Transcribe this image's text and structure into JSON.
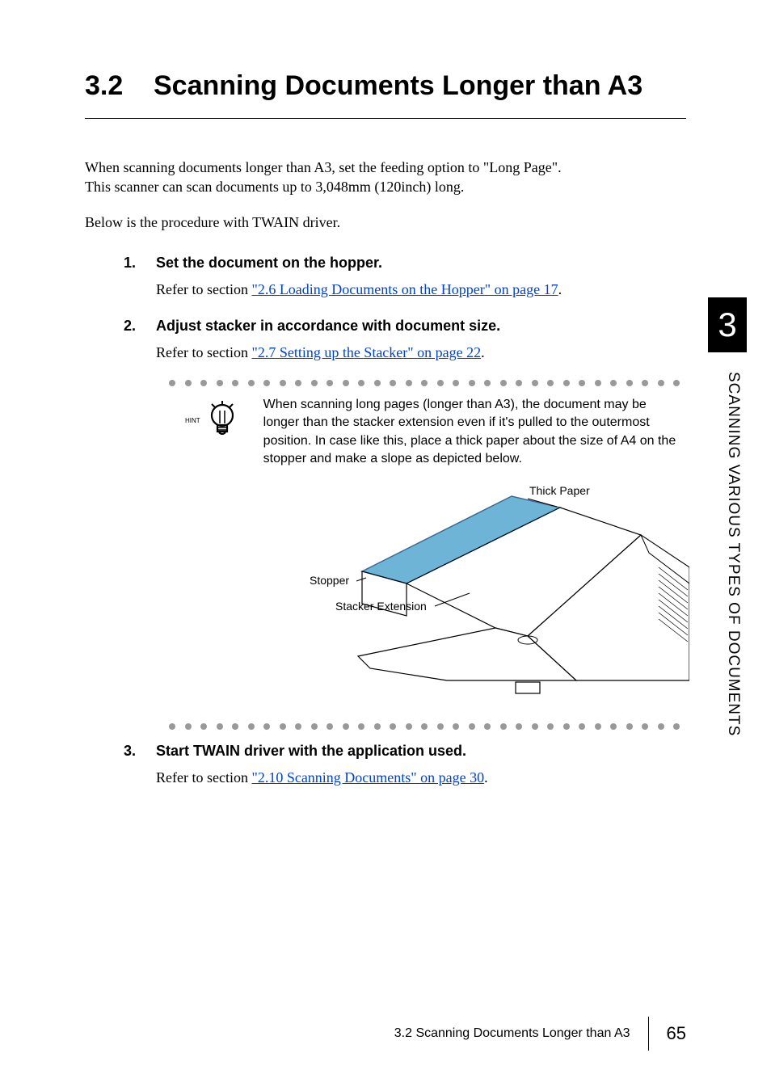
{
  "heading": {
    "num": "3.2",
    "title": "Scanning Documents Longer than A3"
  },
  "intro1_a": "When scanning documents longer than A3, set the feeding option to \"Long Page\".",
  "intro1_b": "This scanner can scan documents up to 3,048mm (120inch) long.",
  "intro2": "Below is the procedure with TWAIN driver.",
  "steps": [
    {
      "num": "1.",
      "title": "Set the document on the hopper.",
      "body_prefix": "Refer to section ",
      "link": "\"2.6 Loading Documents on the Hopper\" on page 17",
      "body_suffix": "."
    },
    {
      "num": "2.",
      "title": "Adjust stacker in accordance with document size.",
      "body_prefix": "Refer to section ",
      "link": "\"2.7 Setting up the Stacker\" on page 22",
      "body_suffix": "."
    },
    {
      "num": "3.",
      "title": "Start TWAIN driver with the application used.",
      "body_prefix": "Refer to section ",
      "link": "\"2.10 Scanning Documents\" on page 30",
      "body_suffix": "."
    }
  ],
  "hint": {
    "label": "HINT",
    "text": "When scanning long pages (longer than A3), the document may be longer than the stacker extension even if it's pulled to the outermost position. In case like this, place a thick paper about the size of A4 on the stopper and make a slope as depicted below."
  },
  "diagram": {
    "thick_paper": "Thick Paper",
    "stopper": "Stopper",
    "stacker_ext": "Stacker Extension"
  },
  "side": {
    "chapter": "3",
    "title": "SCANNING VARIOUS TYPES OF DOCUMENTS"
  },
  "footer": {
    "section": "3.2 Scanning Documents Longer than A3",
    "page": "65"
  }
}
